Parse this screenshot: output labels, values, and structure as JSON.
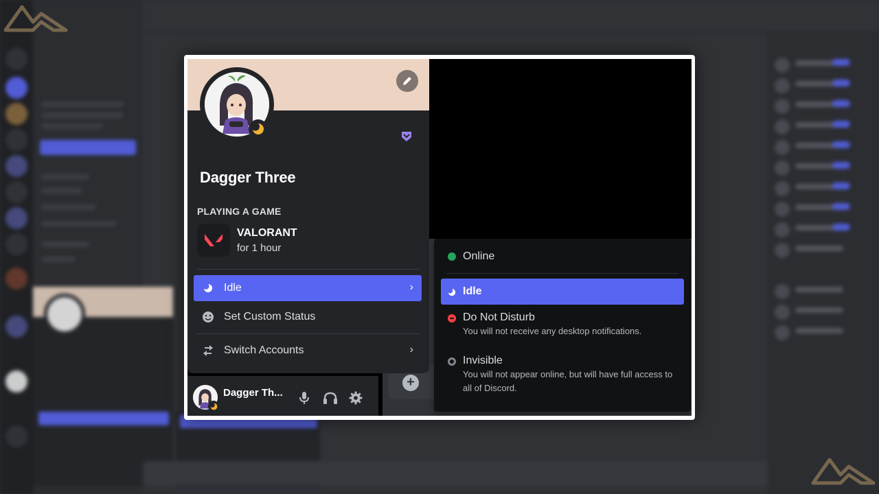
{
  "profile": {
    "username": "Dagger Three",
    "activity_header": "PLAYING A GAME",
    "game": {
      "name": "VALORANT",
      "elapsed": "for 1 hour"
    },
    "menu": {
      "status_label": "Idle",
      "custom_status_label": "Set Custom Status",
      "switch_accounts_label": "Switch Accounts"
    }
  },
  "user_panel": {
    "name": "Dagger Th..."
  },
  "status_menu": {
    "options": [
      {
        "label": "Online",
        "description": "",
        "color": "#23a55a"
      },
      {
        "label": "Idle",
        "description": "",
        "color": "#f0b232"
      },
      {
        "label": "Do Not Disturb",
        "description": "You will not receive any desktop notifications.",
        "color": "#f23f43"
      },
      {
        "label": "Invisible",
        "description": "You will not appear online, but will have full access to all of Discord.",
        "color": "#80848e"
      }
    ]
  },
  "colors": {
    "accent": "#5865f2",
    "banner": "#ecd3c2",
    "idle": "#f0b232"
  },
  "icons": {
    "edit": "pencil-icon",
    "badge": "hypesquad-icon",
    "idle": "moon-icon",
    "custom_status": "smiley-icon",
    "switch_accounts": "switch-accounts-icon",
    "mic": "microphone-icon",
    "headset": "headphones-icon",
    "settings": "gear-icon",
    "add": "plus-icon"
  }
}
